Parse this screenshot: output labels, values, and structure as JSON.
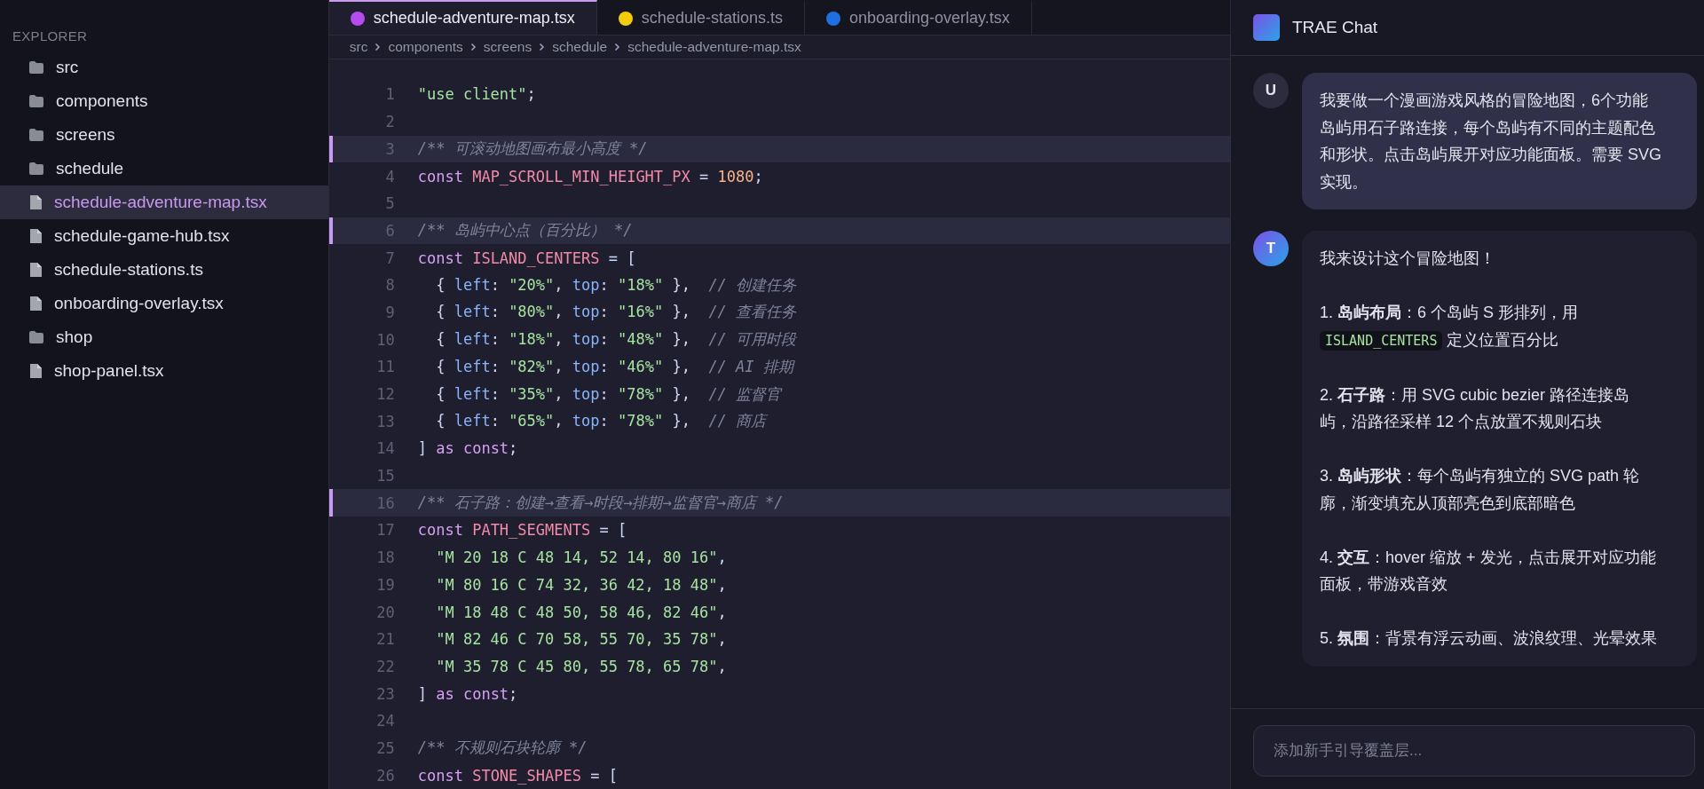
{
  "sidebar": {
    "title": "EXPLORER",
    "items": [
      {
        "kind": "folder",
        "label": "src",
        "selected": false
      },
      {
        "kind": "folder",
        "label": "components",
        "selected": false
      },
      {
        "kind": "folder",
        "label": "screens",
        "selected": false
      },
      {
        "kind": "folder",
        "label": "schedule",
        "selected": false
      },
      {
        "kind": "file",
        "label": "schedule-adventure-map.tsx",
        "selected": true
      },
      {
        "kind": "file",
        "label": "schedule-game-hub.tsx",
        "selected": false
      },
      {
        "kind": "file",
        "label": "schedule-stations.ts",
        "selected": false
      },
      {
        "kind": "file",
        "label": "onboarding-overlay.tsx",
        "selected": false
      },
      {
        "kind": "folder",
        "label": "shop",
        "selected": false
      },
      {
        "kind": "file",
        "label": "shop-panel.tsx",
        "selected": false
      }
    ]
  },
  "tabs": [
    {
      "label": "schedule-adventure-map.tsx",
      "selected": true,
      "color": "#b44cf0"
    },
    {
      "label": "schedule-stations.ts",
      "selected": false,
      "color": "#f2cc0c"
    },
    {
      "label": "onboarding-overlay.tsx",
      "selected": false,
      "color": "#1f6fe0"
    }
  ],
  "breadcrumb": [
    "src",
    "components",
    "screens",
    "schedule",
    "schedule-adventure-map.tsx"
  ],
  "code_lines": [
    {
      "number": "1",
      "highlighted": false,
      "tokens": [
        {
          "kind": "str",
          "text": "\"use client\""
        },
        {
          "kind": "punct",
          "text": ";"
        }
      ]
    },
    {
      "number": "2",
      "highlighted": false
    },
    {
      "number": "3",
      "highlighted": true,
      "tokens": [
        {
          "kind": "comment",
          "text": "/** 可滚动地图画布最小高度 */"
        }
      ]
    },
    {
      "number": "4",
      "highlighted": false,
      "tokens": [
        {
          "kind": "kw",
          "text": "const"
        },
        {
          "kind": "var",
          "text": " MAP_SCROLL_MIN_HEIGHT_PX"
        },
        {
          "kind": "punct",
          "text": " = "
        },
        {
          "kind": "num",
          "text": "1080"
        },
        {
          "kind": "punct",
          "text": ";"
        }
      ]
    },
    {
      "number": "5",
      "highlighted": false
    },
    {
      "number": "6",
      "highlighted": true,
      "tokens": [
        {
          "kind": "comment",
          "text": "/** 岛屿中心点（百分比） */"
        }
      ]
    },
    {
      "number": "7",
      "highlighted": false,
      "tokens": [
        {
          "kind": "kw",
          "text": "const"
        },
        {
          "kind": "var",
          "text": " ISLAND_CENTERS"
        },
        {
          "kind": "punct",
          "text": " = ["
        }
      ]
    },
    {
      "number": "8",
      "highlighted": false,
      "tokens": [
        {
          "kind": "punct",
          "text": "  { "
        },
        {
          "kind": "prop",
          "text": "left"
        },
        {
          "kind": "punct",
          "text": ": "
        },
        {
          "kind": "str",
          "text": "\"20%\""
        },
        {
          "kind": "punct",
          "text": ", "
        },
        {
          "kind": "prop",
          "text": "top"
        },
        {
          "kind": "punct",
          "text": ": "
        },
        {
          "kind": "str",
          "text": "\"18%\""
        },
        {
          "kind": "punct",
          "text": " },  "
        },
        {
          "kind": "comment",
          "text": "// 创建任务"
        }
      ]
    },
    {
      "number": "9",
      "highlighted": false,
      "tokens": [
        {
          "kind": "punct",
          "text": "  { "
        },
        {
          "kind": "prop",
          "text": "left"
        },
        {
          "kind": "punct",
          "text": ": "
        },
        {
          "kind": "str",
          "text": "\"80%\""
        },
        {
          "kind": "punct",
          "text": ", "
        },
        {
          "kind": "prop",
          "text": "top"
        },
        {
          "kind": "punct",
          "text": ": "
        },
        {
          "kind": "str",
          "text": "\"16%\""
        },
        {
          "kind": "punct",
          "text": " },  "
        },
        {
          "kind": "comment",
          "text": "// 查看任务"
        }
      ]
    },
    {
      "number": "10",
      "highlighted": false,
      "tokens": [
        {
          "kind": "punct",
          "text": "  { "
        },
        {
          "kind": "prop",
          "text": "left"
        },
        {
          "kind": "punct",
          "text": ": "
        },
        {
          "kind": "str",
          "text": "\"18%\""
        },
        {
          "kind": "punct",
          "text": ", "
        },
        {
          "kind": "prop",
          "text": "top"
        },
        {
          "kind": "punct",
          "text": ": "
        },
        {
          "kind": "str",
          "text": "\"48%\""
        },
        {
          "kind": "punct",
          "text": " },  "
        },
        {
          "kind": "comment",
          "text": "// 可用时段"
        }
      ]
    },
    {
      "number": "11",
      "highlighted": false,
      "tokens": [
        {
          "kind": "punct",
          "text": "  { "
        },
        {
          "kind": "prop",
          "text": "left"
        },
        {
          "kind": "punct",
          "text": ": "
        },
        {
          "kind": "str",
          "text": "\"82%\""
        },
        {
          "kind": "punct",
          "text": ", "
        },
        {
          "kind": "prop",
          "text": "top"
        },
        {
          "kind": "punct",
          "text": ": "
        },
        {
          "kind": "str",
          "text": "\"46%\""
        },
        {
          "kind": "punct",
          "text": " },  "
        },
        {
          "kind": "comment",
          "text": "// AI 排期"
        }
      ]
    },
    {
      "number": "12",
      "highlighted": false,
      "tokens": [
        {
          "kind": "punct",
          "text": "  { "
        },
        {
          "kind": "prop",
          "text": "left"
        },
        {
          "kind": "punct",
          "text": ": "
        },
        {
          "kind": "str",
          "text": "\"35%\""
        },
        {
          "kind": "punct",
          "text": ", "
        },
        {
          "kind": "prop",
          "text": "top"
        },
        {
          "kind": "punct",
          "text": ": "
        },
        {
          "kind": "str",
          "text": "\"78%\""
        },
        {
          "kind": "punct",
          "text": " },  "
        },
        {
          "kind": "comment",
          "text": "// 监督官"
        }
      ]
    },
    {
      "number": "13",
      "highlighted": false,
      "tokens": [
        {
          "kind": "punct",
          "text": "  { "
        },
        {
          "kind": "prop",
          "text": "left"
        },
        {
          "kind": "punct",
          "text": ": "
        },
        {
          "kind": "str",
          "text": "\"65%\""
        },
        {
          "kind": "punct",
          "text": ", "
        },
        {
          "kind": "prop",
          "text": "top"
        },
        {
          "kind": "punct",
          "text": ": "
        },
        {
          "kind": "str",
          "text": "\"78%\""
        },
        {
          "kind": "punct",
          "text": " },  "
        },
        {
          "kind": "comment",
          "text": "// 商店"
        }
      ]
    },
    {
      "number": "14",
      "highlighted": false,
      "tokens": [
        {
          "kind": "punct",
          "text": "] "
        },
        {
          "kind": "kw",
          "text": "as const"
        },
        {
          "kind": "punct",
          "text": ";"
        }
      ]
    },
    {
      "number": "15",
      "highlighted": false
    },
    {
      "number": "16",
      "highlighted": true,
      "tokens": [
        {
          "kind": "comment",
          "text": "/** 石子路：创建→查看→时段→排期→监督官→商店 */"
        }
      ]
    },
    {
      "number": "17",
      "highlighted": false,
      "tokens": [
        {
          "kind": "kw",
          "text": "const"
        },
        {
          "kind": "var",
          "text": " PATH_SEGMENTS"
        },
        {
          "kind": "punct",
          "text": " = ["
        }
      ]
    },
    {
      "number": "18",
      "highlighted": false,
      "tokens": [
        {
          "kind": "str",
          "text": "  \"M 20 18 C 48 14, 52 14, 80 16\""
        },
        {
          "kind": "punct",
          "text": ","
        }
      ]
    },
    {
      "number": "19",
      "highlighted": false,
      "tokens": [
        {
          "kind": "str",
          "text": "  \"M 80 16 C 74 32, 36 42, 18 48\""
        },
        {
          "kind": "punct",
          "text": ","
        }
      ]
    },
    {
      "number": "20",
      "highlighted": false,
      "tokens": [
        {
          "kind": "str",
          "text": "  \"M 18 48 C 48 50, 58 46, 82 46\""
        },
        {
          "kind": "punct",
          "text": ","
        }
      ]
    },
    {
      "number": "21",
      "highlighted": false,
      "tokens": [
        {
          "kind": "str",
          "text": "  \"M 82 46 C 70 58, 55 70, 35 78\""
        },
        {
          "kind": "punct",
          "text": ","
        }
      ]
    },
    {
      "number": "22",
      "highlighted": false,
      "tokens": [
        {
          "kind": "str",
          "text": "  \"M 35 78 C 45 80, 55 78, 65 78\""
        },
        {
          "kind": "punct",
          "text": ","
        }
      ]
    },
    {
      "number": "23",
      "highlighted": false,
      "tokens": [
        {
          "kind": "punct",
          "text": "] "
        },
        {
          "kind": "kw",
          "text": "as const"
        },
        {
          "kind": "punct",
          "text": ";"
        }
      ]
    },
    {
      "number": "24",
      "highlighted": false
    },
    {
      "number": "25",
      "highlighted": false,
      "tokens": [
        {
          "kind": "comment",
          "text": "/** 不规则石块轮廓 */"
        }
      ]
    },
    {
      "number": "26",
      "highlighted": false,
      "tokens": [
        {
          "kind": "kw",
          "text": "const"
        },
        {
          "kind": "var",
          "text": " STONE_SHAPES"
        },
        {
          "kind": "punct",
          "text": " = ["
        }
      ]
    }
  ],
  "chat": {
    "title": "TRAE Chat",
    "messages": [
      {
        "kind": "user",
        "avatar": "U",
        "paragraphs": [
          [
            {
              "kind": "text",
              "text": "我要做一个漫画游戏风格的冒险地图，6个功能岛屿用石子路连接，每个岛屿有不同的主题配色和形状。点击岛屿展开对应功能面板。需要 SVG 实现。"
            }
          ]
        ]
      },
      {
        "kind": "assistant",
        "avatar": "T",
        "paragraphs": [
          [
            {
              "kind": "text",
              "text": "我来设计这个冒险地图！"
            }
          ],
          [
            {
              "kind": "text",
              "text": "1. **岛屿布局**：6 个岛屿 S 形排列，用 "
            },
            {
              "kind": "code",
              "text": "ISLAND_CENTERS"
            },
            {
              "kind": "text",
              "text": " 定义位置百分比"
            }
          ],
          [
            {
              "kind": "text",
              "text": "2. **石子路**：用 SVG cubic bezier 路径连接岛屿，沿路径采样 12 个点放置不规则石块"
            }
          ],
          [
            {
              "kind": "text",
              "text": "3. **岛屿形状**：每个岛屿有独立的 SVG path 轮廓，渐变填充从顶部亮色到底部暗色"
            }
          ],
          [
            {
              "kind": "text",
              "text": "4. **交互**：hover 缩放 + 发光，点击展开对应功能面板，带游戏音效"
            }
          ],
          [
            {
              "kind": "text",
              "text": "5. **氛围**：背景有浮云动画、波浪纹理、光晕效果"
            }
          ]
        ]
      }
    ],
    "input": {
      "placeholder": "添加新手引导覆盖层..."
    }
  }
}
